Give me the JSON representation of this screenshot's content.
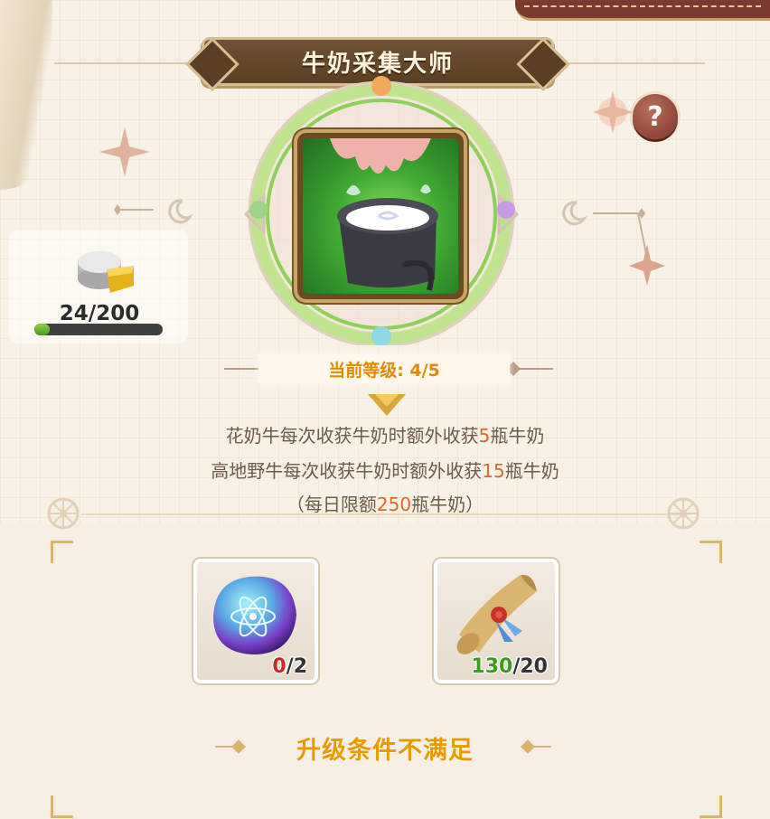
{
  "skill": {
    "title": "牛奶采集大师",
    "level_label": "当前等级: 4/5",
    "description_lines": [
      {
        "before": "花奶牛每次收获牛奶时额外收获",
        "value": "5",
        "after": "瓶牛奶"
      },
      {
        "before": "高地野牛每次收获牛奶时额外收获",
        "value": "15",
        "after": "瓶牛奶"
      },
      {
        "before": "（每日限额",
        "value": "250",
        "after": "瓶牛奶）"
      }
    ]
  },
  "resource": {
    "icon": "coin-stack-icon",
    "count_text": "24/200",
    "progress_fraction": 0.12
  },
  "requirements": [
    {
      "icon": "orb-crystal-icon",
      "have": "0",
      "need": "/2",
      "have_color": "red"
    },
    {
      "icon": "scroll-icon",
      "have": "130",
      "need": "/20",
      "have_color": "green"
    }
  ],
  "status_text": "升级条件不满足",
  "help_icon": "question-mark-icon",
  "colors": {
    "title_banner": "#5a3f24",
    "level_text": "#e08a00",
    "highlight_value": "#e0672a",
    "status_text": "#e89a00",
    "help_button": "#7b3528"
  }
}
